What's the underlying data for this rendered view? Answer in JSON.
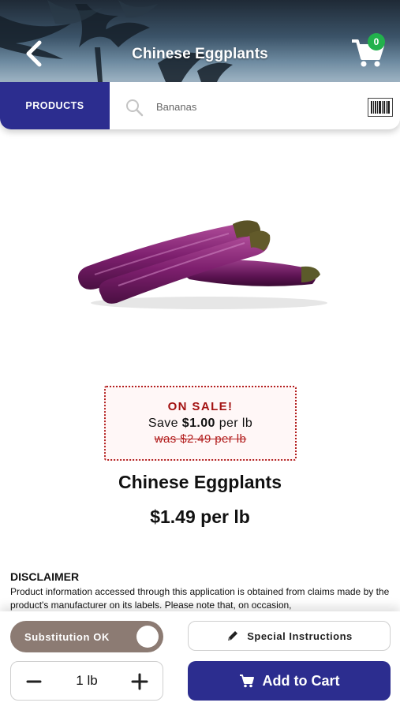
{
  "header": {
    "title": "Chinese Eggplants",
    "cart_count": "0"
  },
  "search": {
    "products_label": "PRODUCTS",
    "placeholder": "Bananas"
  },
  "sale": {
    "title": "ON SALE!",
    "save_prefix": "Save ",
    "save_amount": "$1.00",
    "save_suffix": " per lb",
    "was_price": "was $2.49 per lb"
  },
  "product": {
    "name": "Chinese Eggplants",
    "price": "$1.49 per lb"
  },
  "disclaimer": {
    "title": "DISCLAIMER",
    "text": "Product information accessed through this application is obtained from claims made by the product's manufacturer on its labels. Please note that, on occasion,"
  },
  "actions": {
    "substitution_label": "Substitution OK",
    "special_instructions_label": "Special Instructions",
    "quantity": "1 lb",
    "add_to_cart_label": "Add to Cart"
  },
  "colors": {
    "brand_blue": "#2c2d8f",
    "sale_red": "#b31f1f",
    "badge_green": "#22b14c",
    "toggle_brown": "#8c7b73"
  }
}
